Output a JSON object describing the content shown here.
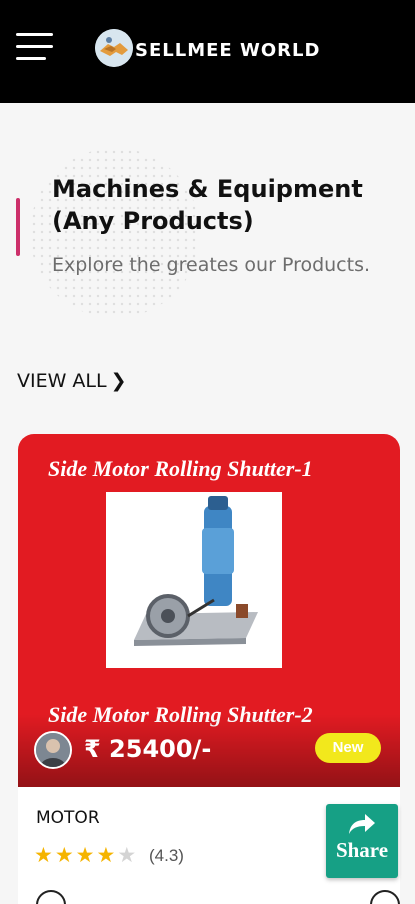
{
  "header": {
    "brand": "SELLMEE WORLD",
    "menu_icon": "hamburger-menu-icon",
    "logo_icon": "handshake-logo-icon",
    "background": "#000000"
  },
  "section": {
    "title": "Machines & Equipment (Any Products)",
    "subtitle": "Explore the greates our Products.",
    "accent_color": "#cc2f6a",
    "view_all": "VIEW ALL",
    "view_all_icon": "chevron-right-icon"
  },
  "product": {
    "image_heading_1": "Side Motor Rolling Shutter-1",
    "image_heading_2": "Side Motor Rolling Shutter-2",
    "image_background": "#e21b22",
    "price": "₹ 25400/-",
    "badge": "New",
    "badge_color": "#f2e81c",
    "name": "MOTOR",
    "rating_value": 4,
    "rating_max": 5,
    "rating_text": "(4.3)"
  },
  "share": {
    "label": "Share",
    "icon": "share-arrow-icon",
    "background": "#16a085"
  }
}
